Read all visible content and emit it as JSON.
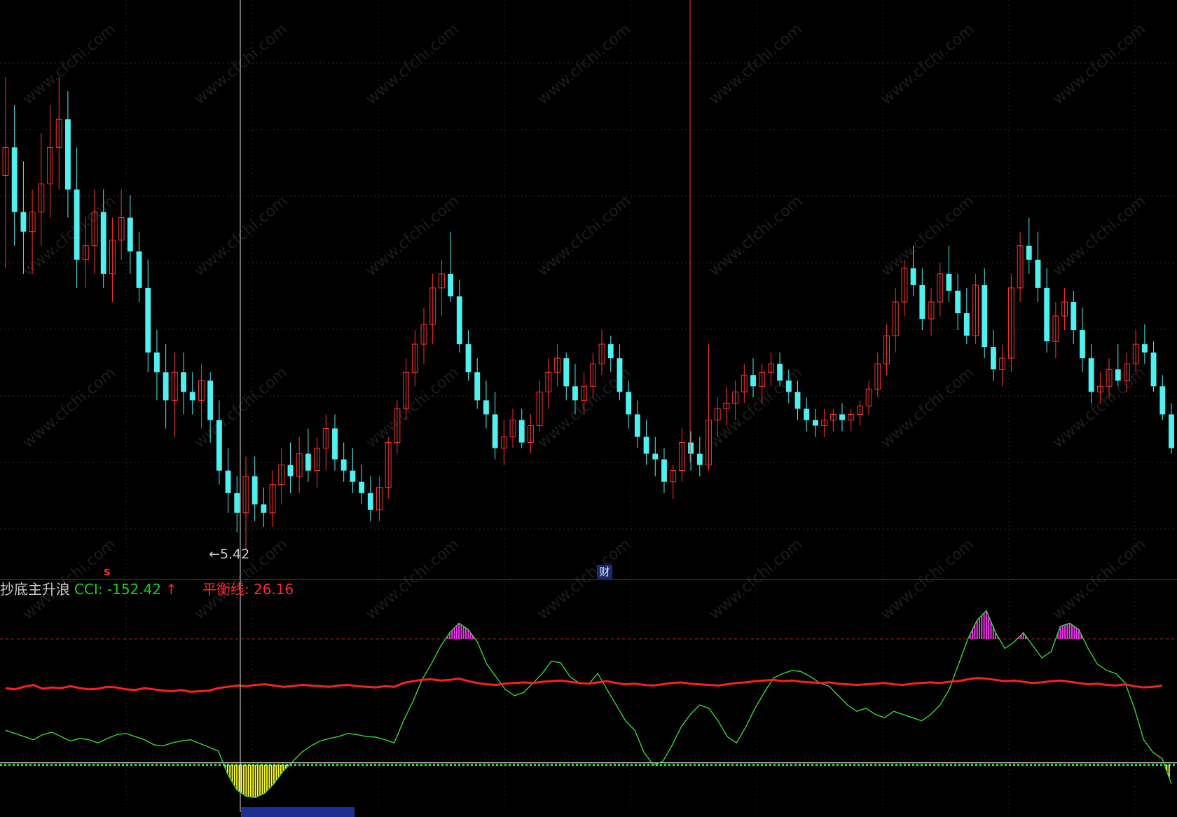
{
  "indicator": {
    "name": "抄底主升浪",
    "cci_label": "CCI: -152.42",
    "cci_arrow": "↑",
    "balance_label": "平衡线: 26.16"
  },
  "price_chart": {
    "low_marker": "←5.42",
    "cai_badge": "财",
    "signal_mark": "s",
    "low_value": 5.42,
    "candles": [
      {
        "o": 6.75,
        "h": 7.1,
        "l": 6.42,
        "c": 6.85
      },
      {
        "o": 6.85,
        "h": 7.0,
        "l": 6.5,
        "c": 6.62
      },
      {
        "o": 6.62,
        "h": 6.8,
        "l": 6.4,
        "c": 6.55
      },
      {
        "o": 6.55,
        "h": 6.7,
        "l": 6.4,
        "c": 6.62
      },
      {
        "o": 6.62,
        "h": 6.9,
        "l": 6.5,
        "c": 6.72
      },
      {
        "o": 6.72,
        "h": 7.0,
        "l": 6.6,
        "c": 6.85
      },
      {
        "o": 6.85,
        "h": 7.1,
        "l": 6.7,
        "c": 6.95
      },
      {
        "o": 6.95,
        "h": 7.05,
        "l": 6.6,
        "c": 6.7
      },
      {
        "o": 6.7,
        "h": 6.85,
        "l": 6.35,
        "c": 6.45
      },
      {
        "o": 6.45,
        "h": 6.6,
        "l": 6.35,
        "c": 6.5
      },
      {
        "o": 6.5,
        "h": 6.7,
        "l": 6.4,
        "c": 6.62
      },
      {
        "o": 6.62,
        "h": 6.7,
        "l": 6.35,
        "c": 6.4
      },
      {
        "o": 6.4,
        "h": 6.6,
        "l": 6.3,
        "c": 6.52
      },
      {
        "o": 6.52,
        "h": 6.7,
        "l": 6.45,
        "c": 6.6
      },
      {
        "o": 6.6,
        "h": 6.68,
        "l": 6.4,
        "c": 6.48
      },
      {
        "o": 6.48,
        "h": 6.55,
        "l": 6.3,
        "c": 6.35
      },
      {
        "o": 6.35,
        "h": 6.45,
        "l": 6.05,
        "c": 6.12
      },
      {
        "o": 6.12,
        "h": 6.2,
        "l": 5.95,
        "c": 6.05
      },
      {
        "o": 6.05,
        "h": 6.15,
        "l": 5.85,
        "c": 5.95
      },
      {
        "o": 5.95,
        "h": 6.12,
        "l": 5.82,
        "c": 6.05
      },
      {
        "o": 6.05,
        "h": 6.12,
        "l": 5.9,
        "c": 5.98
      },
      {
        "o": 5.98,
        "h": 6.05,
        "l": 5.9,
        "c": 5.95
      },
      {
        "o": 5.95,
        "h": 6.08,
        "l": 5.85,
        "c": 6.02
      },
      {
        "o": 6.02,
        "h": 6.05,
        "l": 5.8,
        "c": 5.88
      },
      {
        "o": 5.88,
        "h": 5.95,
        "l": 5.65,
        "c": 5.7
      },
      {
        "o": 5.7,
        "h": 5.78,
        "l": 5.55,
        "c": 5.62
      },
      {
        "o": 5.62,
        "h": 5.68,
        "l": 5.48,
        "c": 5.55
      },
      {
        "o": 5.55,
        "h": 5.75,
        "l": 5.42,
        "c": 5.68
      },
      {
        "o": 5.68,
        "h": 5.75,
        "l": 5.52,
        "c": 5.58
      },
      {
        "o": 5.58,
        "h": 5.64,
        "l": 5.5,
        "c": 5.55
      },
      {
        "o": 5.55,
        "h": 5.7,
        "l": 5.5,
        "c": 5.65
      },
      {
        "o": 5.65,
        "h": 5.78,
        "l": 5.58,
        "c": 5.72
      },
      {
        "o": 5.72,
        "h": 5.8,
        "l": 5.62,
        "c": 5.68
      },
      {
        "o": 5.68,
        "h": 5.82,
        "l": 5.62,
        "c": 5.76
      },
      {
        "o": 5.76,
        "h": 5.85,
        "l": 5.66,
        "c": 5.7
      },
      {
        "o": 5.7,
        "h": 5.82,
        "l": 5.64,
        "c": 5.78
      },
      {
        "o": 5.78,
        "h": 5.9,
        "l": 5.7,
        "c": 5.85
      },
      {
        "o": 5.85,
        "h": 5.9,
        "l": 5.7,
        "c": 5.74
      },
      {
        "o": 5.74,
        "h": 5.8,
        "l": 5.66,
        "c": 5.7
      },
      {
        "o": 5.7,
        "h": 5.78,
        "l": 5.62,
        "c": 5.66
      },
      {
        "o": 5.66,
        "h": 5.72,
        "l": 5.58,
        "c": 5.62
      },
      {
        "o": 5.62,
        "h": 5.68,
        "l": 5.52,
        "c": 5.56
      },
      {
        "o": 5.56,
        "h": 5.68,
        "l": 5.52,
        "c": 5.64
      },
      {
        "o": 5.64,
        "h": 5.82,
        "l": 5.6,
        "c": 5.8
      },
      {
        "o": 5.8,
        "h": 5.95,
        "l": 5.76,
        "c": 5.92
      },
      {
        "o": 5.92,
        "h": 6.1,
        "l": 5.88,
        "c": 6.05
      },
      {
        "o": 6.05,
        "h": 6.2,
        "l": 6.0,
        "c": 6.15
      },
      {
        "o": 6.15,
        "h": 6.28,
        "l": 6.08,
        "c": 6.22
      },
      {
        "o": 6.22,
        "h": 6.4,
        "l": 6.15,
        "c": 6.35
      },
      {
        "o": 6.35,
        "h": 6.45,
        "l": 6.25,
        "c": 6.4
      },
      {
        "o": 6.4,
        "h": 6.55,
        "l": 6.3,
        "c": 6.32
      },
      {
        "o": 6.32,
        "h": 6.38,
        "l": 6.12,
        "c": 6.15
      },
      {
        "o": 6.15,
        "h": 6.2,
        "l": 6.02,
        "c": 6.05
      },
      {
        "o": 6.05,
        "h": 6.1,
        "l": 5.92,
        "c": 5.95
      },
      {
        "o": 5.95,
        "h": 6.02,
        "l": 5.85,
        "c": 5.9
      },
      {
        "o": 5.9,
        "h": 5.98,
        "l": 5.74,
        "c": 5.78
      },
      {
        "o": 5.78,
        "h": 5.88,
        "l": 5.72,
        "c": 5.82
      },
      {
        "o": 5.82,
        "h": 5.92,
        "l": 5.78,
        "c": 5.88
      },
      {
        "o": 5.88,
        "h": 5.92,
        "l": 5.78,
        "c": 5.8
      },
      {
        "o": 5.8,
        "h": 5.9,
        "l": 5.76,
        "c": 5.86
      },
      {
        "o": 5.86,
        "h": 6.02,
        "l": 5.84,
        "c": 5.98
      },
      {
        "o": 5.98,
        "h": 6.1,
        "l": 5.92,
        "c": 6.05
      },
      {
        "o": 6.05,
        "h": 6.15,
        "l": 6.0,
        "c": 6.1
      },
      {
        "o": 6.1,
        "h": 6.12,
        "l": 5.95,
        "c": 6.0
      },
      {
        "o": 6.0,
        "h": 6.08,
        "l": 5.9,
        "c": 5.95
      },
      {
        "o": 5.95,
        "h": 6.05,
        "l": 5.9,
        "c": 6.0
      },
      {
        "o": 6.0,
        "h": 6.12,
        "l": 5.96,
        "c": 6.08
      },
      {
        "o": 6.08,
        "h": 6.2,
        "l": 6.04,
        "c": 6.15
      },
      {
        "o": 6.15,
        "h": 6.18,
        "l": 6.05,
        "c": 6.1
      },
      {
        "o": 6.1,
        "h": 6.15,
        "l": 5.95,
        "c": 5.98
      },
      {
        "o": 5.98,
        "h": 6.02,
        "l": 5.85,
        "c": 5.9
      },
      {
        "o": 5.9,
        "h": 5.95,
        "l": 5.78,
        "c": 5.82
      },
      {
        "o": 5.82,
        "h": 5.88,
        "l": 5.72,
        "c": 5.76
      },
      {
        "o": 5.76,
        "h": 5.82,
        "l": 5.68,
        "c": 5.74
      },
      {
        "o": 5.74,
        "h": 5.78,
        "l": 5.62,
        "c": 5.66
      },
      {
        "o": 5.66,
        "h": 5.72,
        "l": 5.6,
        "c": 5.7
      },
      {
        "o": 5.7,
        "h": 5.85,
        "l": 5.66,
        "c": 5.8
      },
      {
        "o": 5.8,
        "h": 5.84,
        "l": 5.7,
        "c": 5.76
      },
      {
        "o": 5.76,
        "h": 5.82,
        "l": 5.68,
        "c": 5.72
      },
      {
        "o": 5.72,
        "h": 6.15,
        "l": 5.7,
        "c": 5.88
      },
      {
        "o": 5.88,
        "h": 5.96,
        "l": 5.82,
        "c": 5.92
      },
      {
        "o": 5.92,
        "h": 6.0,
        "l": 5.86,
        "c": 5.94
      },
      {
        "o": 5.94,
        "h": 6.02,
        "l": 5.88,
        "c": 5.98
      },
      {
        "o": 5.98,
        "h": 6.08,
        "l": 5.94,
        "c": 6.04
      },
      {
        "o": 6.04,
        "h": 6.1,
        "l": 5.96,
        "c": 6.0
      },
      {
        "o": 6.0,
        "h": 6.08,
        "l": 5.94,
        "c": 6.05
      },
      {
        "o": 6.05,
        "h": 6.12,
        "l": 6.0,
        "c": 6.08
      },
      {
        "o": 6.08,
        "h": 6.12,
        "l": 6.0,
        "c": 6.02
      },
      {
        "o": 6.02,
        "h": 6.06,
        "l": 5.94,
        "c": 5.98
      },
      {
        "o": 5.98,
        "h": 6.02,
        "l": 5.88,
        "c": 5.92
      },
      {
        "o": 5.92,
        "h": 5.96,
        "l": 5.84,
        "c": 5.88
      },
      {
        "o": 5.88,
        "h": 5.92,
        "l": 5.82,
        "c": 5.86
      },
      {
        "o": 5.86,
        "h": 5.92,
        "l": 5.82,
        "c": 5.88
      },
      {
        "o": 5.88,
        "h": 5.92,
        "l": 5.84,
        "c": 5.9
      },
      {
        "o": 5.9,
        "h": 5.94,
        "l": 5.84,
        "c": 5.88
      },
      {
        "o": 5.88,
        "h": 5.92,
        "l": 5.84,
        "c": 5.9
      },
      {
        "o": 5.9,
        "h": 5.95,
        "l": 5.86,
        "c": 5.93
      },
      {
        "o": 5.93,
        "h": 6.02,
        "l": 5.9,
        "c": 5.99
      },
      {
        "o": 5.99,
        "h": 6.12,
        "l": 5.96,
        "c": 6.08
      },
      {
        "o": 6.08,
        "h": 6.22,
        "l": 6.04,
        "c": 6.18
      },
      {
        "o": 6.18,
        "h": 6.35,
        "l": 6.12,
        "c": 6.3
      },
      {
        "o": 6.3,
        "h": 6.45,
        "l": 6.25,
        "c": 6.42
      },
      {
        "o": 6.42,
        "h": 6.5,
        "l": 6.32,
        "c": 6.36
      },
      {
        "o": 6.36,
        "h": 6.42,
        "l": 6.2,
        "c": 6.24
      },
      {
        "o": 6.24,
        "h": 6.35,
        "l": 6.18,
        "c": 6.3
      },
      {
        "o": 6.3,
        "h": 6.44,
        "l": 6.25,
        "c": 6.4
      },
      {
        "o": 6.4,
        "h": 6.5,
        "l": 6.3,
        "c": 6.34
      },
      {
        "o": 6.34,
        "h": 6.4,
        "l": 6.2,
        "c": 6.26
      },
      {
        "o": 6.26,
        "h": 6.35,
        "l": 6.15,
        "c": 6.18
      },
      {
        "o": 6.18,
        "h": 6.4,
        "l": 6.15,
        "c": 6.36
      },
      {
        "o": 6.36,
        "h": 6.42,
        "l": 6.1,
        "c": 6.14
      },
      {
        "o": 6.14,
        "h": 6.2,
        "l": 6.02,
        "c": 6.06
      },
      {
        "o": 6.06,
        "h": 6.15,
        "l": 6.0,
        "c": 6.1
      },
      {
        "o": 6.1,
        "h": 6.4,
        "l": 6.05,
        "c": 6.35
      },
      {
        "o": 6.35,
        "h": 6.55,
        "l": 6.3,
        "c": 6.5
      },
      {
        "o": 6.5,
        "h": 6.6,
        "l": 6.4,
        "c": 6.45
      },
      {
        "o": 6.45,
        "h": 6.55,
        "l": 6.3,
        "c": 6.35
      },
      {
        "o": 6.35,
        "h": 6.42,
        "l": 6.12,
        "c": 6.16
      },
      {
        "o": 6.16,
        "h": 6.3,
        "l": 6.1,
        "c": 6.25
      },
      {
        "o": 6.25,
        "h": 6.35,
        "l": 6.2,
        "c": 6.3
      },
      {
        "o": 6.3,
        "h": 6.34,
        "l": 6.15,
        "c": 6.2
      },
      {
        "o": 6.2,
        "h": 6.28,
        "l": 6.05,
        "c": 6.1
      },
      {
        "o": 6.1,
        "h": 6.15,
        "l": 5.94,
        "c": 5.98
      },
      {
        "o": 5.98,
        "h": 6.05,
        "l": 5.94,
        "c": 6.0
      },
      {
        "o": 6.0,
        "h": 6.1,
        "l": 5.96,
        "c": 6.06
      },
      {
        "o": 6.06,
        "h": 6.15,
        "l": 6.0,
        "c": 6.02
      },
      {
        "o": 6.02,
        "h": 6.12,
        "l": 5.98,
        "c": 6.08
      },
      {
        "o": 6.08,
        "h": 6.2,
        "l": 6.05,
        "c": 6.15
      },
      {
        "o": 6.15,
        "h": 6.22,
        "l": 6.08,
        "c": 6.12
      },
      {
        "o": 6.12,
        "h": 6.16,
        "l": 5.98,
        "c": 6.0
      },
      {
        "o": 6.0,
        "h": 6.04,
        "l": 5.88,
        "c": 5.9
      },
      {
        "o": 5.9,
        "h": 5.94,
        "l": 5.76,
        "c": 5.78
      }
    ]
  },
  "indicator_data": {
    "overbought_level": 100,
    "oversold_level": -100,
    "cci": [
      -45,
      -50,
      -55,
      -60,
      -52,
      -48,
      -55,
      -62,
      -58,
      -60,
      -65,
      -58,
      -52,
      -50,
      -55,
      -60,
      -68,
      -70,
      -65,
      -62,
      -60,
      -66,
      -72,
      -78,
      -115,
      -140,
      -150,
      -152,
      -145,
      -130,
      -110,
      -95,
      -80,
      -70,
      -62,
      -58,
      -55,
      -50,
      -52,
      -55,
      -56,
      -60,
      -65,
      -30,
      0,
      35,
      60,
      88,
      110,
      125,
      115,
      95,
      60,
      40,
      20,
      10,
      15,
      30,
      45,
      65,
      62,
      40,
      30,
      28,
      45,
      20,
      -5,
      -30,
      -45,
      -80,
      -100,
      -95,
      -70,
      -40,
      -20,
      -5,
      -10,
      -30,
      -55,
      -65,
      -40,
      -10,
      15,
      38,
      45,
      50,
      48,
      40,
      30,
      25,
      10,
      -5,
      -15,
      -10,
      -20,
      -25,
      -15,
      -20,
      -25,
      -30,
      -20,
      -5,
      20,
      60,
      100,
      130,
      145,
      110,
      85,
      95,
      110,
      90,
      70,
      80,
      120,
      125,
      115,
      85,
      60,
      50,
      45,
      30,
      -10,
      -60,
      -80,
      -90,
      -130
    ],
    "balance": [
      22,
      20,
      24,
      27,
      21,
      23,
      22,
      25,
      22,
      20,
      21,
      24,
      23,
      20,
      19,
      22,
      20,
      18,
      17,
      19,
      16,
      17,
      18,
      22,
      24,
      26,
      25,
      27,
      28,
      26,
      24,
      25,
      27,
      26,
      25,
      24,
      26,
      27,
      25,
      24,
      23,
      25,
      24,
      30,
      33,
      35,
      36,
      34,
      35,
      37,
      33,
      30,
      28,
      27,
      29,
      30,
      31,
      30,
      32,
      33,
      34,
      32,
      30,
      29,
      31,
      33,
      30,
      28,
      29,
      27,
      26,
      28,
      30,
      31,
      29,
      28,
      27,
      26,
      28,
      30,
      31,
      33,
      34,
      35,
      33,
      34,
      32,
      31,
      30,
      31,
      29,
      28,
      27,
      28,
      29,
      30,
      28,
      27,
      29,
      30,
      31,
      30,
      32,
      33,
      36,
      38,
      37,
      35,
      33,
      34,
      32,
      30,
      31,
      33,
      34,
      32,
      30,
      28,
      29,
      27,
      26,
      28,
      25,
      23,
      24,
      26
    ]
  }
}
